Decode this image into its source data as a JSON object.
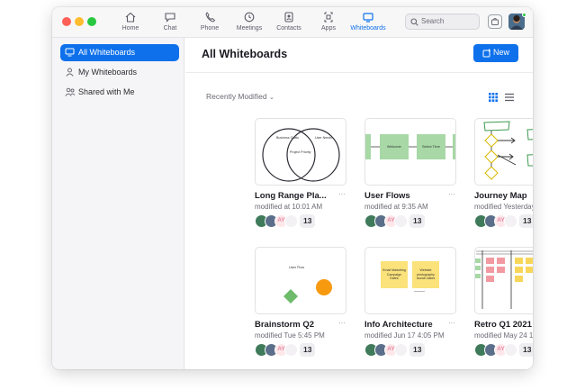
{
  "nav": {
    "items": [
      {
        "label": "Home",
        "icon": "home-icon"
      },
      {
        "label": "Chat",
        "icon": "chat-icon"
      },
      {
        "label": "Phone",
        "icon": "phone-icon"
      },
      {
        "label": "Meetings",
        "icon": "clock-icon"
      },
      {
        "label": "Contacts",
        "icon": "contacts-icon"
      },
      {
        "label": "Apps",
        "icon": "apps-icon"
      },
      {
        "label": "Whiteboards",
        "icon": "whiteboard-icon",
        "active": true
      }
    ],
    "search_placeholder": "Search"
  },
  "sidebar": {
    "items": [
      {
        "label": "All Whiteboards",
        "active": true
      },
      {
        "label": "My Whiteboards"
      },
      {
        "label": "Shared with Me"
      }
    ]
  },
  "main": {
    "title": "All Whiteboards",
    "new_label": "New",
    "sort_label": "Recently Modified"
  },
  "cards": [
    {
      "title": "Long Range Pla...",
      "modified": "modified at 10:01 AM",
      "count": "13",
      "thumb": {
        "left_circle": "Business Goals",
        "right_circle": "User Needs",
        "overlap": "Project Priority"
      }
    },
    {
      "title": "User Flows",
      "modified": "modified at 9:35 AM",
      "count": "13",
      "thumb": {
        "box1": "Welcome",
        "box2": "Select Time"
      }
    },
    {
      "title": "Journey Map",
      "modified": "modified Yesterday 10...",
      "count": "13"
    },
    {
      "title": "Brainstorm Q2",
      "modified": "modified Tue 5:45 PM",
      "count": "13",
      "thumb": {
        "label": "User Flow"
      }
    },
    {
      "title": "Info Architecture",
      "modified": "modified Jun 17 4:05 PM",
      "count": "13",
      "thumb": {
        "note1": "Email Marketing Campaign Dates",
        "note2": "Website photography launch dates"
      }
    },
    {
      "title": "Retro Q1 2021",
      "modified": "modified May 24 11:05 AM",
      "count": "13"
    }
  ],
  "collaborator_initials": "AY",
  "colors": {
    "accent": "#0e71eb",
    "sidebar_bg": "#f5f5f7"
  }
}
